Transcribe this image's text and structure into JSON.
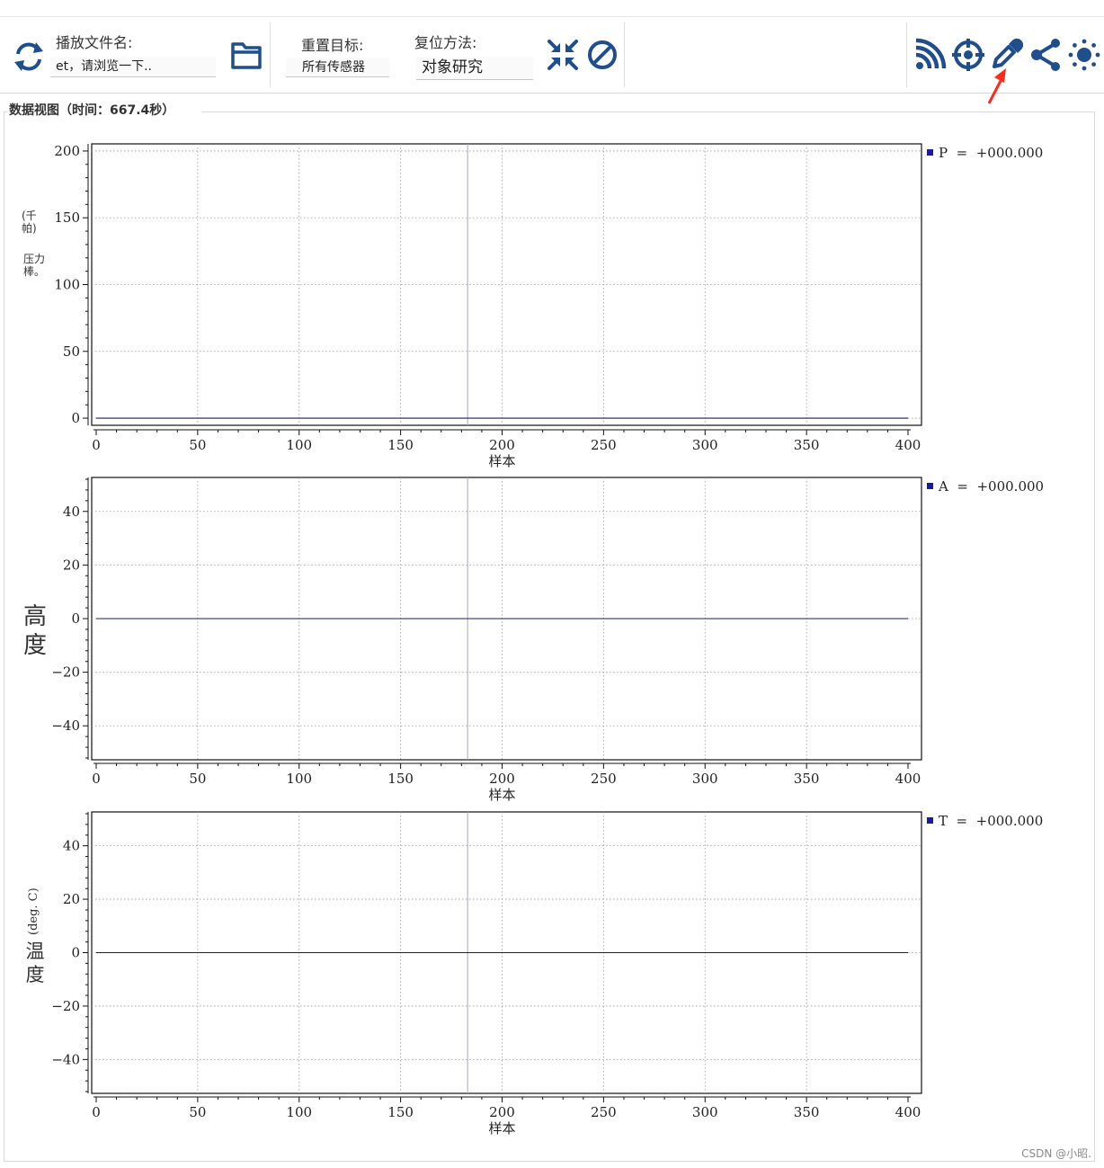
{
  "toolbar": {
    "refresh_icon": "refresh-icon",
    "play_file_label": "播放文件名:",
    "play_file_value": "et，请浏览一下..",
    "folder_icon": "folder-icon",
    "reset_target_label": "重置目标:",
    "reset_target_value": "所有传感器",
    "reset_method_label": "复位方法:",
    "reset_method_value": "对象研究",
    "compress_icon": "compress-icon",
    "cancel_icon": "cancel-icon",
    "right_icons": [
      "rss-icon",
      "crosshair-icon",
      "eyedropper-icon",
      "share-icon",
      "brightness-icon"
    ]
  },
  "colors": {
    "icon_blue": "#1f4e8c",
    "series": "#1a1aa8",
    "annotation_arrow": "#ff2a1a"
  },
  "data_view": {
    "title": "数据视图（时间：667.4秒）"
  },
  "charts": {
    "pressure": {
      "legend": "P  =  +000.000",
      "ylabel_parts": [
        "(千帕)",
        "压力棒。"
      ]
    },
    "altitude": {
      "legend": "A  =  +000.000",
      "ylabel_parts": [
        "高",
        "度"
      ]
    },
    "temperature": {
      "legend": "T  =  +000.000",
      "ylabel_parts": [
        "温",
        "度",
        "(deg. C)"
      ]
    }
  },
  "chart_data": [
    {
      "type": "line",
      "xlabel": "样本",
      "ylabel": "",
      "xlim": [
        0,
        400
      ],
      "ylim": [
        -4,
        204
      ],
      "xticks": [
        0,
        50,
        100,
        150,
        200,
        250,
        300,
        350,
        400
      ],
      "yticks": [
        0,
        50,
        100,
        150,
        200
      ],
      "grid": true,
      "legend_position": "right",
      "cursor_x": 183,
      "series": [
        {
          "name": "P",
          "x": [
            0,
            400
          ],
          "y": [
            0,
            0
          ]
        }
      ]
    },
    {
      "type": "line",
      "xlabel": "样本",
      "ylabel": "",
      "xlim": [
        0,
        400
      ],
      "ylim": [
        -52,
        52
      ],
      "xticks": [
        0,
        50,
        100,
        150,
        200,
        250,
        300,
        350,
        400
      ],
      "yticks": [
        -40,
        -20,
        0,
        20,
        40
      ],
      "grid": true,
      "legend_position": "right",
      "cursor_x": 183,
      "series": [
        {
          "name": "A",
          "x": [
            0,
            400
          ],
          "y": [
            0,
            0
          ]
        }
      ]
    },
    {
      "type": "line",
      "xlabel": "样本",
      "ylabel": "",
      "xlim": [
        0,
        400
      ],
      "ylim": [
        -52,
        52
      ],
      "xticks": [
        0,
        50,
        100,
        150,
        200,
        250,
        300,
        350,
        400
      ],
      "yticks": [
        -40,
        -20,
        0,
        20,
        40
      ],
      "grid": true,
      "legend_position": "right",
      "cursor_x": 183,
      "series": [
        {
          "name": "T",
          "x": [
            0,
            400
          ],
          "y": [
            0,
            0
          ]
        }
      ]
    }
  ],
  "watermark": "CSDN @小昭."
}
